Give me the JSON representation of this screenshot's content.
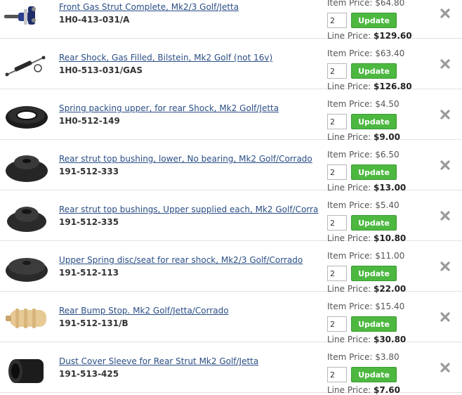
{
  "labels": {
    "item_price": "Item Price:",
    "line_price": "Line Price:",
    "update": "Update"
  },
  "items": [
    {
      "name": "Front Gas Strut Complete, Mk2/3 Golf/Jetta",
      "sku": "1H0-413-031/A",
      "item_price": "$64.80",
      "qty": "2",
      "line_price": "$129.60",
      "image": "front-strut"
    },
    {
      "name": "Rear Shock, Gas Filled, Bilstein, Mk2 Golf (not 16v)",
      "sku": "1H0-513-031/GAS",
      "item_price": "$63.40",
      "qty": "2",
      "line_price": "$126.80",
      "image": "rear-shock"
    },
    {
      "name": "Spring packing upper, for rear Shock, Mk2 Golf/Jetta",
      "sku": "1H0-512-149",
      "item_price": "$4.50",
      "qty": "2",
      "line_price": "$9.00",
      "image": "spring-packing"
    },
    {
      "name": "Rear strut top bushing, lower, No bearing, Mk2 Golf/Corrado",
      "sku": "191-512-333",
      "item_price": "$6.50",
      "qty": "2",
      "line_price": "$13.00",
      "image": "strut-bushing"
    },
    {
      "name": "Rear strut top bushings, Upper supplied each, Mk2 Golf/Corra",
      "sku": "191-512-335",
      "item_price": "$5.40",
      "qty": "2",
      "line_price": "$10.80",
      "image": "strut-bushing-upper"
    },
    {
      "name": "Upper Spring disc/seat for rear shock, Mk2/3 Golf/Corrado",
      "sku": "191-512-113",
      "item_price": "$11.00",
      "qty": "2",
      "line_price": "$22.00",
      "image": "spring-disc"
    },
    {
      "name": "Rear Bump Stop. Mk2 Golf/Jetta/Corrado",
      "sku": "191-512-131/B",
      "item_price": "$15.40",
      "qty": "2",
      "line_price": "$30.80",
      "image": "bump-stop"
    },
    {
      "name": "Dust Cover Sleeve for Rear Strut Mk2 Golf/Jetta",
      "sku": "191-513-425",
      "item_price": "$3.80",
      "qty": "2",
      "line_price": "$7.60",
      "image": "dust-cover"
    }
  ],
  "colors": {
    "link": "#2a4e86",
    "update_button": "#4cb840",
    "remove_icon": "#9a9a9a"
  }
}
